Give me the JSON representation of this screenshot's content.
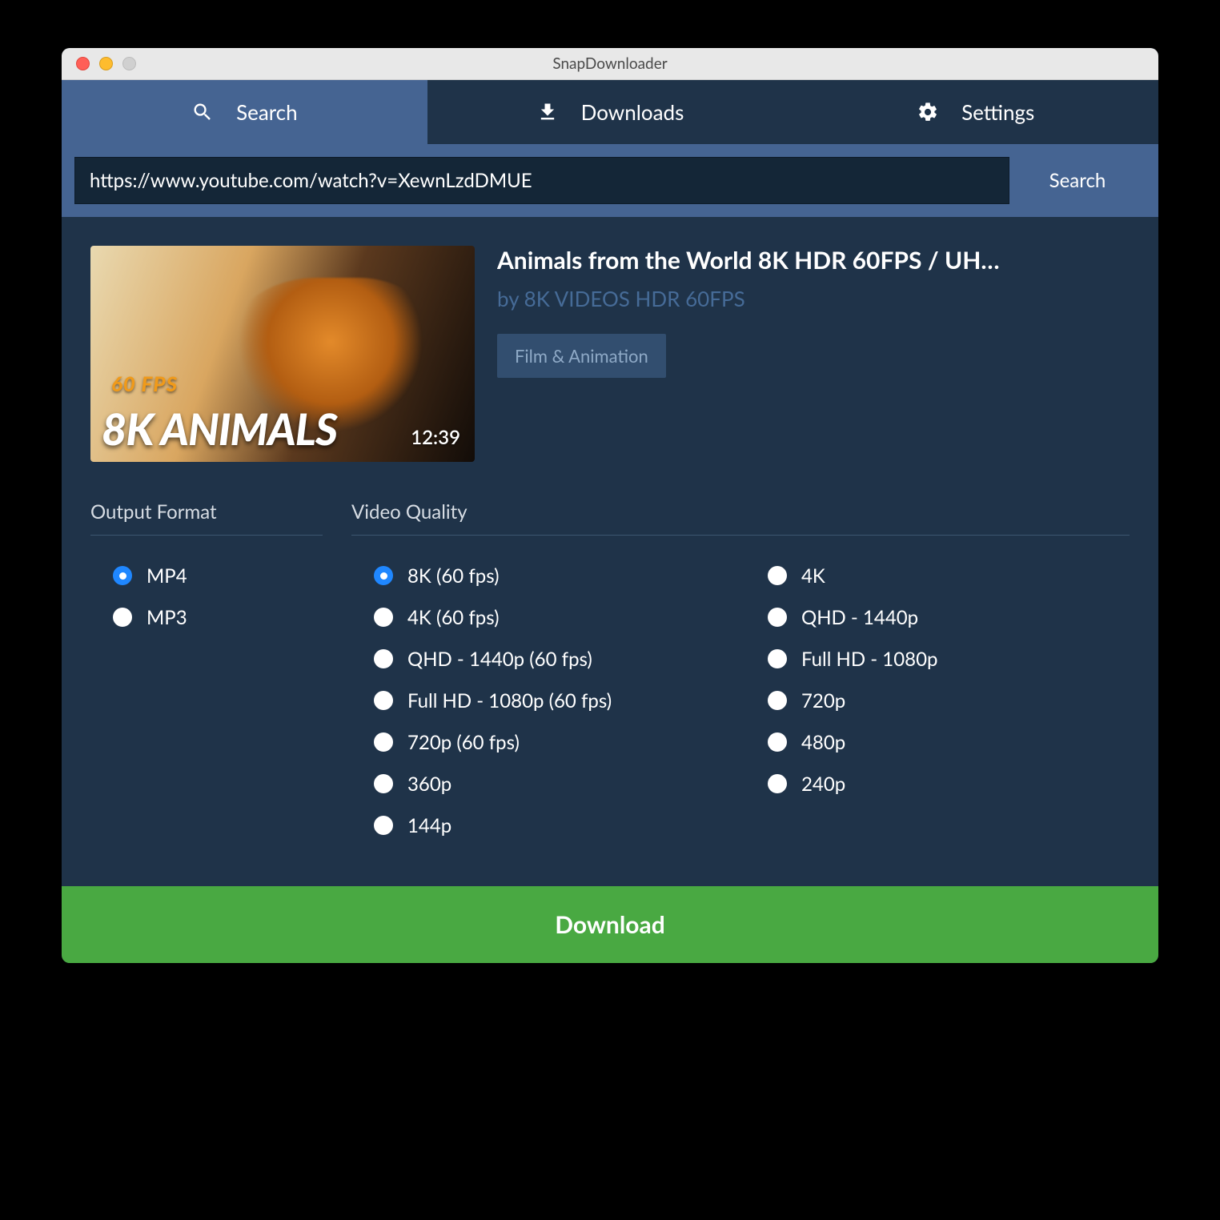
{
  "window": {
    "title": "SnapDownloader"
  },
  "tabs": {
    "search": "Search",
    "downloads": "Downloads",
    "settings": "Settings"
  },
  "search": {
    "url": "https://www.youtube.com/watch?v=XewnLzdDMUE",
    "button": "Search"
  },
  "video": {
    "title": "Animals from the World 8K HDR 60FPS / UH…",
    "author_prefix": "by ",
    "author": "8K VIDEOS HDR 60FPS",
    "category": "Film & Animation",
    "duration": "12:39",
    "thumb_fps": "60 FPS",
    "thumb_big": "8K ANIMALS"
  },
  "format": {
    "heading": "Output Format",
    "options": [
      "MP4",
      "MP3"
    ],
    "selected": "MP4"
  },
  "quality": {
    "heading": "Video Quality",
    "col1": [
      "8K (60 fps)",
      "4K (60 fps)",
      "QHD - 1440p (60 fps)",
      "Full HD - 1080p (60 fps)",
      "720p (60 fps)",
      "360p",
      "144p"
    ],
    "col2": [
      "4K",
      "QHD - 1440p",
      "Full HD - 1080p",
      "720p",
      "480p",
      "240p"
    ],
    "selected": "8K (60 fps)"
  },
  "download_button": "Download"
}
